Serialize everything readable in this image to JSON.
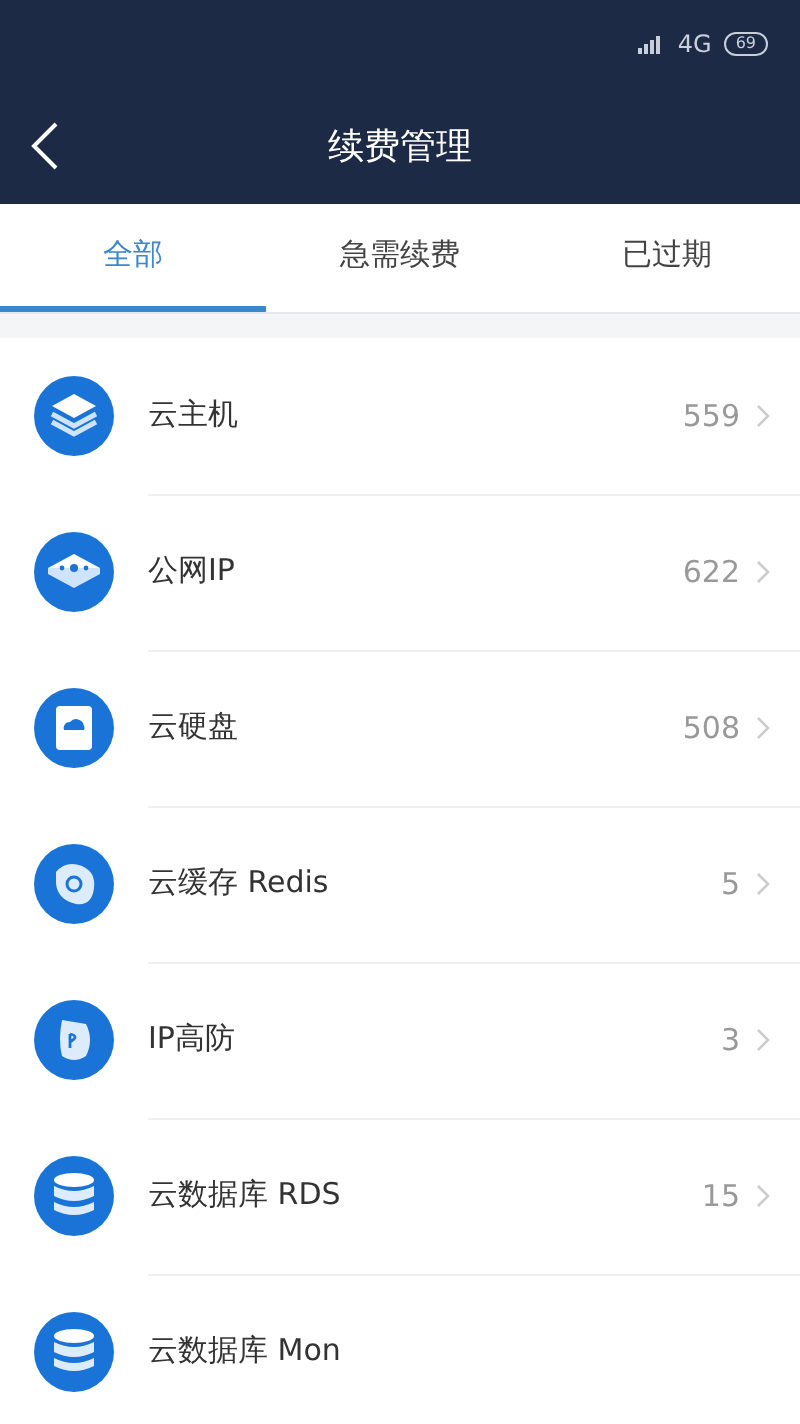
{
  "status_bar": {
    "network": "4G",
    "battery": "69"
  },
  "header": {
    "title": "续费管理"
  },
  "tabs": [
    {
      "label": "全部",
      "selected": true
    },
    {
      "label": "急需续费",
      "selected": false
    },
    {
      "label": "已过期",
      "selected": false
    }
  ],
  "items": [
    {
      "kind": "layers",
      "label": "云主机",
      "count": "559"
    },
    {
      "kind": "network",
      "label": "公网IP",
      "count": "622"
    },
    {
      "kind": "disk",
      "label": "云硬盘",
      "count": "508"
    },
    {
      "kind": "cache",
      "label": "云缓存 Redis",
      "count": "5"
    },
    {
      "kind": "shield",
      "label": "IP高防",
      "count": "3"
    },
    {
      "kind": "database",
      "label": "云数据库 RDS",
      "count": "15"
    },
    {
      "kind": "database",
      "label": "云数据库 Mon"
    }
  ]
}
